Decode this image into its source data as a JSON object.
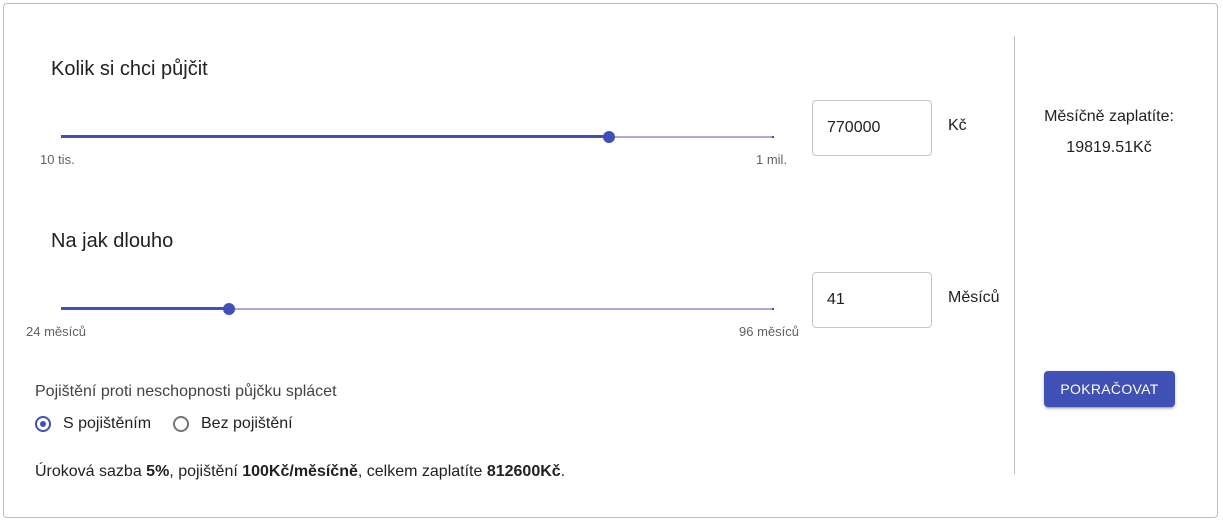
{
  "amount": {
    "title": "Kolik si chci půjčit",
    "min_label": "10 tis.",
    "max_label": "1 mil.",
    "slider_fraction": 0.768,
    "value": "770000",
    "unit": "Kč"
  },
  "duration": {
    "title": "Na jak dlouho",
    "min_label": "24 měsíců",
    "max_label": "96 měsíců",
    "slider_fraction": 0.236,
    "value": "41",
    "unit": "Měsíců"
  },
  "insurance": {
    "label": "Pojištění proti neschopnosti půjčku splácet",
    "options": [
      {
        "label": "S pojištěním",
        "selected": true
      },
      {
        "label": "Bez pojištění",
        "selected": false
      }
    ]
  },
  "summary": {
    "prefix": "Úroková sazba ",
    "rate": "5%",
    "mid1": ", pojištění ",
    "insurance_fee": "100Kč/měsíčně",
    "mid2": ", celkem zaplatíte ",
    "total": "812600Kč",
    "suffix": "."
  },
  "side": {
    "monthly_label": "Měsíčně zaplatíte:",
    "monthly_value": "19819.51Kč",
    "continue_label": "POKRAČOVAT"
  },
  "colors": {
    "primary": "#3f51b5",
    "rail": "#a7acd9"
  }
}
